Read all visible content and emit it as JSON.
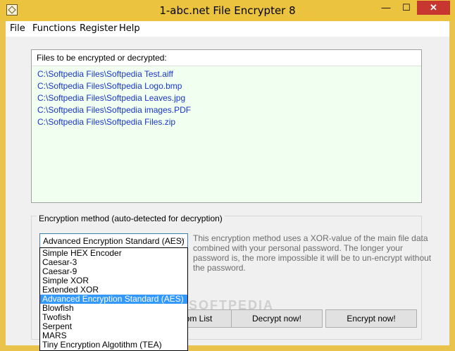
{
  "window": {
    "title": "1-abc.net File Encrypter 8",
    "controls": {
      "minimize": "—",
      "maximize": "☐",
      "close": "✕"
    }
  },
  "menu": {
    "file": "File",
    "functions": "Functions",
    "register": "Register",
    "help": "Help"
  },
  "files": {
    "header": "Files to be encrypted or decrypted:",
    "items": [
      "C:\\Softpedia Files\\Softpedia Test.aiff",
      "C:\\Softpedia Files\\Softpedia Logo.bmp",
      "C:\\Softpedia Files\\Softpedia Leaves.jpg",
      "C:\\Softpedia Files\\Softpedia images.PDF",
      "C:\\Softpedia Files\\Softpedia Files.zip"
    ]
  },
  "encryption": {
    "group_label": "Encryption method (auto-detected for decryption)",
    "selected": "Advanced Encryption Standard (AES)",
    "description_lines": [
      "This encryption method uses a XOR-value of the main file data",
      "combined with your personal password. The longer your",
      "password is, the more impossible it will be to un-encrypt without",
      "the password."
    ],
    "options": [
      "Simple HEX Encoder",
      "Caesar-3",
      "Caesar-9",
      "Simple XOR",
      "Extended XOR",
      "Advanced Encryption Standard (AES)",
      "Blowfish",
      "Twofish",
      "Serpent",
      "MARS",
      "Tiny Encryption Algotithm (TEA)"
    ],
    "selected_index": 5
  },
  "buttons": {
    "from_list": "om List",
    "decrypt": "Decrypt now!",
    "encrypt": "Encrypt now!"
  },
  "watermark": "SOFTPEDIA"
}
